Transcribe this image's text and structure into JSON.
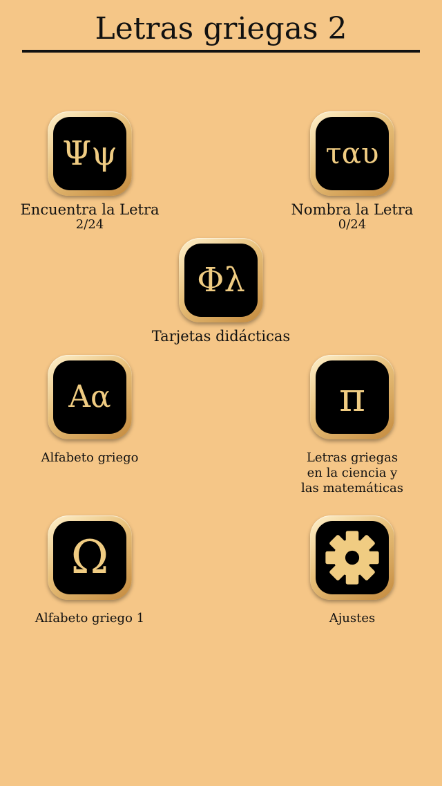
{
  "header": {
    "title": "Letras griegas 2"
  },
  "tiles": {
    "find": {
      "glyph": "Ψψ",
      "label": "Encuentra la Letra",
      "progress": "2/24"
    },
    "name": {
      "glyph": "ταυ",
      "label": "Nombra la Letra",
      "progress": "0/24"
    },
    "flash": {
      "glyph": "Φλ",
      "label": "Tarjetas didácticas"
    },
    "alphabet": {
      "glyph": "Aα",
      "label": "Alfabeto griego"
    },
    "science": {
      "glyph": "π",
      "label_lines": [
        "Letras griegas",
        "en la ciencia y",
        "las matemáticas"
      ]
    },
    "alphabet1": {
      "glyph": "Ω",
      "label": "Alfabeto griego 1"
    },
    "settings": {
      "icon": "gear-icon",
      "label": "Ajustes"
    }
  },
  "colors": {
    "background": "#f5c687",
    "icon_fill": "#000000",
    "glyph": "#f0cc82",
    "frame": "#e8c07a"
  }
}
